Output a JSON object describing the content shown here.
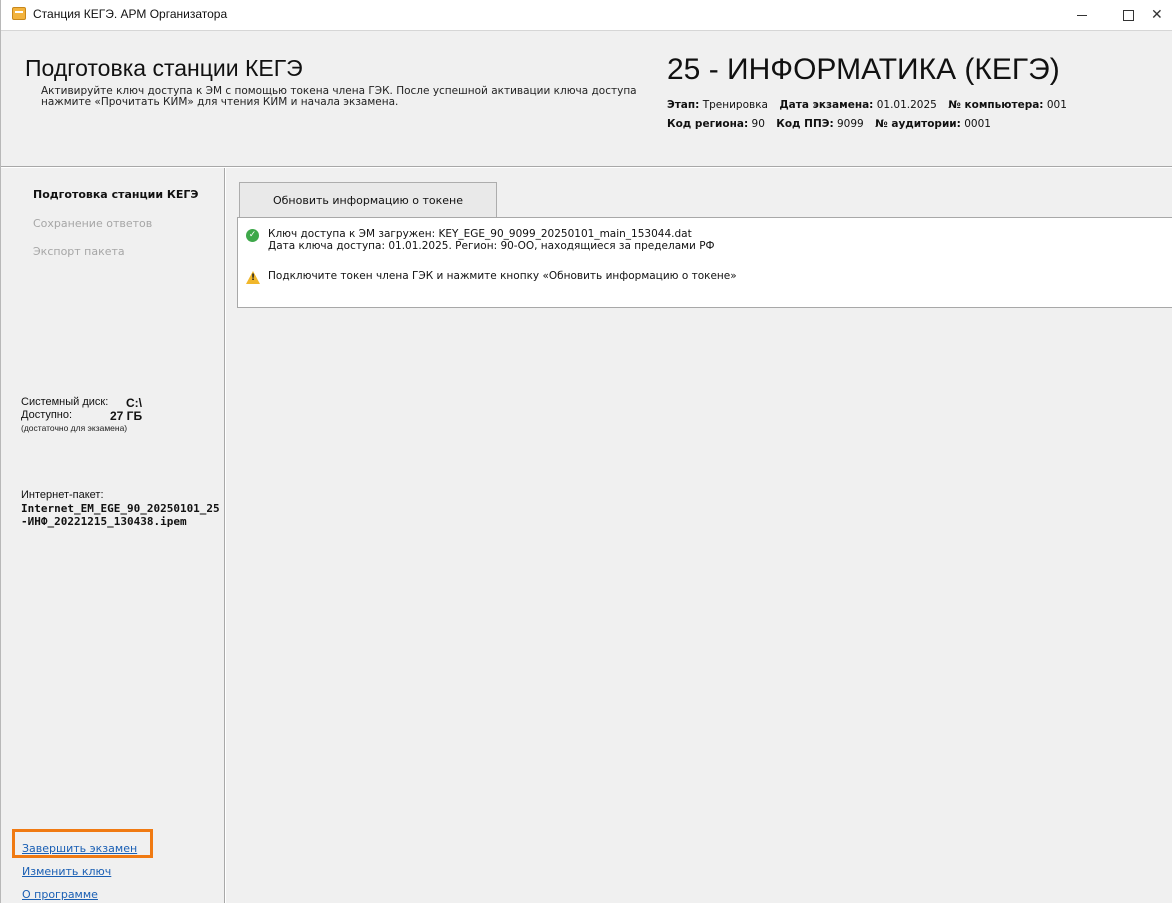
{
  "window": {
    "title": "Станция КЕГЭ. АРМ Организатора",
    "minimize_glyph": "",
    "maximize_glyph": "",
    "close_glyph": "✕"
  },
  "header": {
    "title": "Подготовка станции КЕГЭ",
    "description": "Активируйте ключ доступа к ЭМ с помощью токена члена ГЭК. После успешной активации ключа доступа нажмите «Прочитать КИМ» для чтения КИМ и начала экзамена.",
    "subject": "25 - ИНФОРМАТИКА (КЕГЭ)",
    "meta": {
      "stage_label": "Этап:",
      "stage_value": "Тренировка",
      "exam_date_label": "Дата экзамена:",
      "exam_date_value": "01.01.2025",
      "computer_label": "№ компьютера:",
      "computer_value": "001",
      "region_label": "Код региона:",
      "region_value": "90",
      "ppe_label": "Код ППЭ:",
      "ppe_value": "9099",
      "room_label": "№ аудитории:",
      "room_value": "0001"
    }
  },
  "sidebar": {
    "nav": [
      {
        "label": "Подготовка станции КЕГЭ",
        "state": "active"
      },
      {
        "label": "Сохранение ответов",
        "state": "disabled"
      },
      {
        "label": "Экспорт пакета",
        "state": "disabled"
      }
    ],
    "disk": {
      "system_label": "Системный диск:",
      "system_value": "C:\\",
      "available_label": "Доступно:",
      "available_value": "27 ГБ",
      "note": "(достаточно для экзамена)"
    },
    "package": {
      "label": "Интернет-пакет:",
      "name": "Internet_EM_EGE_90_20250101_25-ИНФ_20221215_130438.ipem"
    },
    "links": [
      {
        "label": "Завершить экзамен"
      },
      {
        "label": "Изменить ключ"
      },
      {
        "label": "О программе"
      }
    ]
  },
  "main": {
    "refresh_button": "Обновить информацию о токене",
    "messages": [
      {
        "icon": "check-circle-icon",
        "line1": "Ключ доступа к ЭМ загружен: KEY_EGE_90_9099_20250101_main_153044.dat",
        "line2": "Дата ключа доступа: 01.01.2025. Регион: 90-ОО, находящиеся за пределами РФ"
      },
      {
        "icon": "warning-icon",
        "line1": "Подключите токен члена ГЭК и нажмите кнопку «Обновить информацию о токене»"
      }
    ]
  },
  "colors": {
    "accent_highlight": "#f07a12",
    "link": "#1a5fb4",
    "success": "#3ea84a",
    "warning": "#f1b72b",
    "panel_bg": "#f0f0f0"
  }
}
